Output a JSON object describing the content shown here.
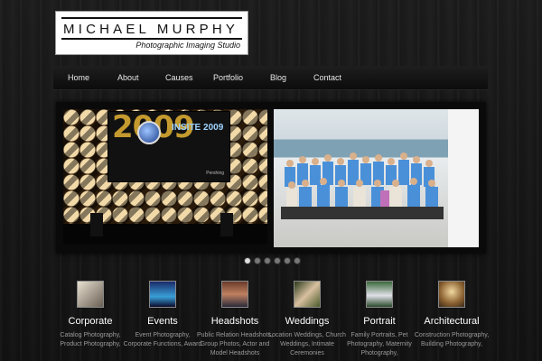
{
  "logo": {
    "name": "MICHAEL MURPHY",
    "subtitle": "Photographic Imaging Studio"
  },
  "nav": {
    "items": [
      {
        "label": "Home"
      },
      {
        "label": "About"
      },
      {
        "label": "Causes"
      },
      {
        "label": "Portfolio"
      },
      {
        "label": "Blog"
      },
      {
        "label": "Contact"
      }
    ]
  },
  "slider": {
    "left_slide": {
      "year": "2009",
      "brand": "INSITE 2009",
      "tag": "Pershing"
    },
    "dots_count": 6,
    "active_dot": 0
  },
  "categories": [
    {
      "title": "Corporate",
      "desc": "Catalog Photography, Product Photography,"
    },
    {
      "title": "Events",
      "desc": "Event Photography, Corporate Functions, Award"
    },
    {
      "title": "Headshots",
      "desc": "Public Relation Headshots, Group Photos, Actor and Model Headshots"
    },
    {
      "title": "Weddings",
      "desc": "Location Weddings, Church Weddings, Intimate Ceremonies"
    },
    {
      "title": "Portrait",
      "desc": "Family Portraits, Pet Photography, Maternity Photography,"
    },
    {
      "title": "Architectural",
      "desc": "Construction Photography, Building Photography,"
    }
  ],
  "colors": {
    "background": "#161616",
    "nav_bg": "#141414",
    "text_light": "#ffffff",
    "text_muted": "#9a9a9a",
    "accent_gold": "#c49a2f"
  }
}
